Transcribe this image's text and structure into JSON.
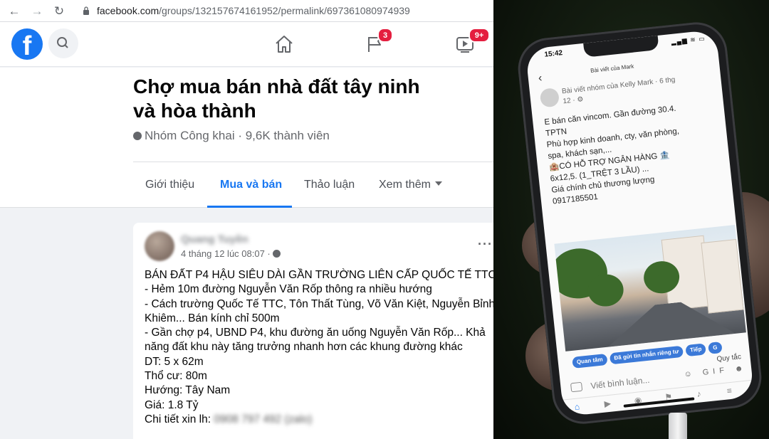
{
  "browser": {
    "url_host": "facebook.com",
    "url_path": "/groups/132157674161952/permalink/697361080974939"
  },
  "facebook": {
    "logo": "f",
    "notifications_badge": "3",
    "video_badge": "9+",
    "icons": [
      "back-arrow-icon",
      "forward-arrow-icon",
      "reload-icon",
      "lock-icon",
      "search-icon",
      "home-icon",
      "flag-icon",
      "video-icon",
      "globe-icon",
      "more-icon"
    ]
  },
  "group": {
    "title_line1": "Chợ mua bán nhà đất tây ninh",
    "title_line2": "và hòa thành",
    "meta": "Nhóm Công khai · 9,6K thành viên",
    "tabs": [
      {
        "label": "Giới thiệu"
      },
      {
        "label": "Mua và bán"
      },
      {
        "label": "Thảo luận"
      },
      {
        "label": "Xem thêm"
      }
    ],
    "active_tab": "Mua và bán"
  },
  "post": {
    "author": "Quang Tuyền",
    "time": "4 tháng 12 lúc 08:07 ·",
    "more": "···",
    "lines": [
      "BÁN ĐẤT P4 HẬU SIÊU DÀI GẦN TRƯỜNG LIÊN CẤP QUỐC TẾ TTC",
      "- Hẻm 10m đường Nguyễn Văn Rốp thông ra nhiều hướng",
      "- Cách trường Quốc Tế TTC, Tôn Thất Tùng, Võ Văn Kiệt, Nguyễn Bỉnh",
      "Khiêm... Bán kính chỉ 500m",
      "- Gần chợ p4, UBND P4, khu đường ăn uống Nguyễn Văn Rốp... Khả",
      "năng đất khu này tăng trưởng nhanh hơn các khung đường khác",
      "DT: 5 x 62m",
      "Thổ cư: 80m",
      "Hướng: Tây Nam",
      "Giá: 1.8 Tỷ"
    ],
    "contact_label": "Chi tiết xin lh:",
    "contact_value": "0908 797 492 (zalo)"
  },
  "phone": {
    "status_time": "15:42",
    "status_icons": "▂▄▆ ≋ ▭",
    "header": "Bài viết của Mark",
    "sub_line1": "Bài viết nhóm của Kelly Mark · 6 thg",
    "sub_line2": "12 · ⚙",
    "body_lines": [
      "E bán căn vincom. Gần đường 30.4.",
      "TPTN",
      "Phù hợp kinh doanh, cty, văn phòng,",
      "spa, khách sạn,...",
      "🏨CÓ HỖ TRỢ NGÂN HÀNG 🏦",
      "6x12,5. (1_TRỆT 3 LẦU) ...",
      "Giá chính chủ thương lượng",
      "0917185501"
    ],
    "chips": [
      "Quan tâm",
      "Đã gửi tin nhắn riêng tư",
      "Tiếp",
      "G"
    ],
    "rules": "Quy tắc",
    "comment_placeholder": "Viết bình luận...",
    "comment_icons": "☺ GIF ☻"
  }
}
